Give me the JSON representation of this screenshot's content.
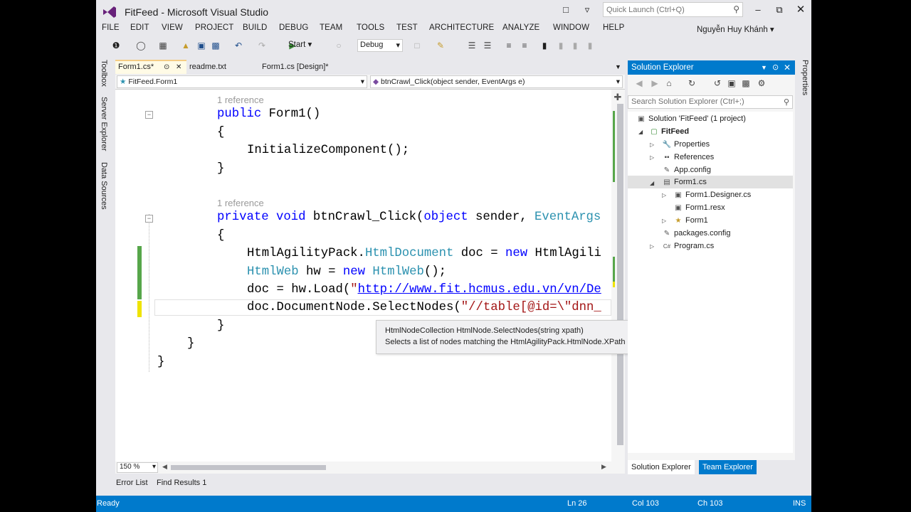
{
  "window": {
    "title": "FitFeed - Microsoft Visual Studio",
    "quick_launch_placeholder": "Quick Launch (Ctrl+Q)",
    "user_name": "Nguyễn Huy Khánh"
  },
  "menu": [
    "FILE",
    "EDIT",
    "VIEW",
    "PROJECT",
    "BUILD",
    "DEBUG",
    "TEAM",
    "TOOLS",
    "TEST",
    "ARCHITECTURE",
    "ANALYZE",
    "WINDOW",
    "HELP"
  ],
  "toolbar": {
    "start_label": "Start",
    "config": "Debug"
  },
  "left_tabs": [
    "Toolbox",
    "Server Explorer",
    "Data Sources"
  ],
  "right_tabs": [
    "Properties"
  ],
  "doc_tabs": [
    {
      "label": "Form1.cs*",
      "active": true
    },
    {
      "label": "readme.txt",
      "active": false
    },
    {
      "label": "Form1.cs [Design]*",
      "active": false
    }
  ],
  "navbar": {
    "class_selector": "FitFeed.Form1",
    "member_selector": "btnCrawl_Click(object sender, EventArgs e)"
  },
  "code": {
    "ref1": "1 reference",
    "ref2": "1 reference",
    "l1_kw": "public",
    "l1_rest": " Form1()",
    "l2": "{",
    "l3": "InitializeComponent();",
    "l4": "}",
    "l5_kw1": "private",
    "l5_kw2": "void",
    "l5_mid": " btnCrawl_Click(",
    "l5_kw3": "object",
    "l5_mid2": " sender, ",
    "l5_ty": "EventArgs",
    "l6": "{",
    "l7_a": "HtmlAgilityPack.",
    "l7_ty": "HtmlDocument",
    "l7_b": " doc = ",
    "l7_kw": "new",
    "l7_c": " HtmlAgili",
    "l8_ty": "HtmlWeb",
    "l8_b": " hw = ",
    "l8_kw": "new",
    "l8_ty2": "HtmlWeb",
    "l8_c": "();",
    "l9_a": "doc = hw.Load(",
    "l9_q": "\"",
    "l9_url": "http://www.fit.hcmus.edu.vn/vn/De",
    "l10_a": "doc.DocumentNode.SelectNodes(",
    "l10_str": "\"//table[@id=\\\"dnn_",
    "l11": "}",
    "l12": "}",
    "l13": "}"
  },
  "tooltip": {
    "signature": "HtmlNodeCollection HtmlNode.SelectNodes(string xpath)",
    "description": "Selects a list of nodes matching the HtmlAgilityPack.HtmlNode.XPath expression."
  },
  "zoom": "150 %",
  "solution_explorer": {
    "title": "Solution Explorer",
    "search_placeholder": "Search Solution Explorer (Ctrl+;)",
    "nodes": [
      {
        "label": "Solution 'FitFeed' (1 project)",
        "icon": "solution-icon"
      },
      {
        "label": "FitFeed",
        "icon": "csharp-project-icon"
      },
      {
        "label": "Properties",
        "icon": "wrench-icon"
      },
      {
        "label": "References",
        "icon": "references-icon"
      },
      {
        "label": "App.config",
        "icon": "config-file-icon"
      },
      {
        "label": "Form1.cs",
        "icon": "form-icon"
      },
      {
        "label": "Form1.Designer.cs",
        "icon": "cs-file-icon"
      },
      {
        "label": "Form1.resx",
        "icon": "resx-file-icon"
      },
      {
        "label": "Form1",
        "icon": "class-icon"
      },
      {
        "label": "packages.config",
        "icon": "config-file-icon"
      },
      {
        "label": "Program.cs",
        "icon": "cs-file-icon"
      }
    ],
    "tabs": [
      "Solution Explorer",
      "Team Explorer"
    ]
  },
  "bottom_tabs": [
    "Error List",
    "Find Results 1"
  ],
  "status": {
    "state": "Ready",
    "ln": "Ln 26",
    "col": "Col 103",
    "ch": "Ch 103",
    "mode": "INS"
  },
  "colors": {
    "accent": "#007acc",
    "active_tab": "#fffbe6",
    "changed_saved": "#57a64a",
    "changed_unsaved": "#efe300"
  }
}
